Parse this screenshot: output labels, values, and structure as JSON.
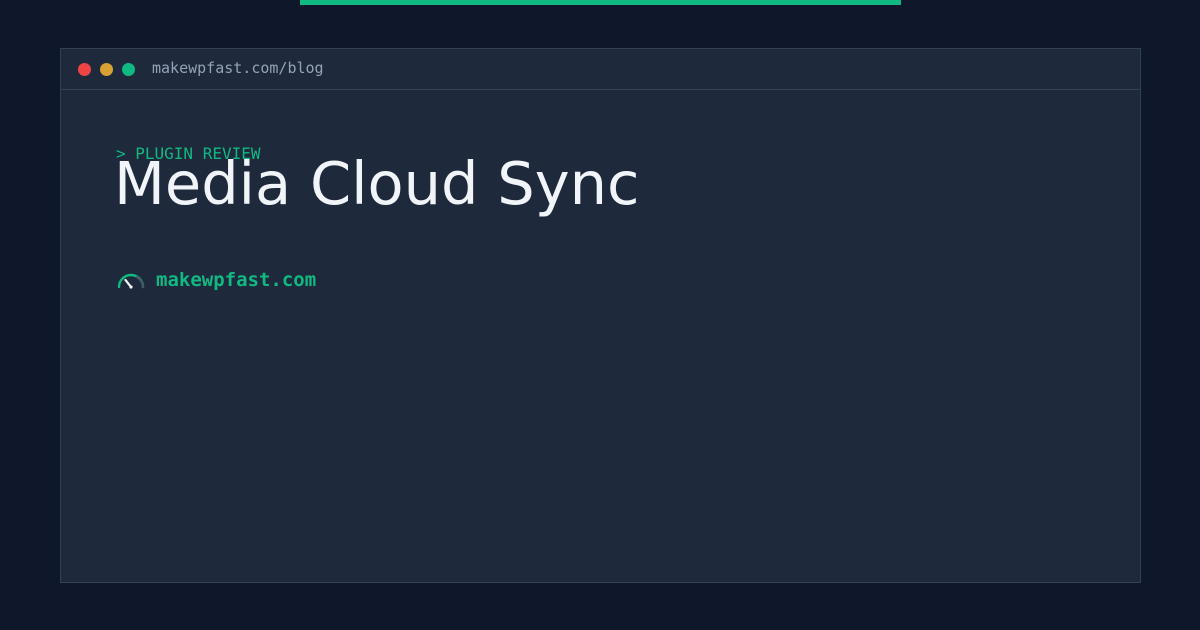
{
  "window": {
    "url": "makewpfast.com/blog"
  },
  "article": {
    "eyebrow": "> PLUGIN REVIEW",
    "title": "Media Cloud Sync"
  },
  "brand": {
    "icon": "speedometer-icon",
    "name": "makewpfast.com"
  },
  "colors": {
    "background": "#0f172a",
    "window": "#1e293b",
    "accent": "#10b981",
    "title": "#f1f5f9",
    "muted": "#94a3b8",
    "dot_red": "#ef4444",
    "dot_yellow": "#d9a033",
    "dot_green": "#10b981"
  }
}
